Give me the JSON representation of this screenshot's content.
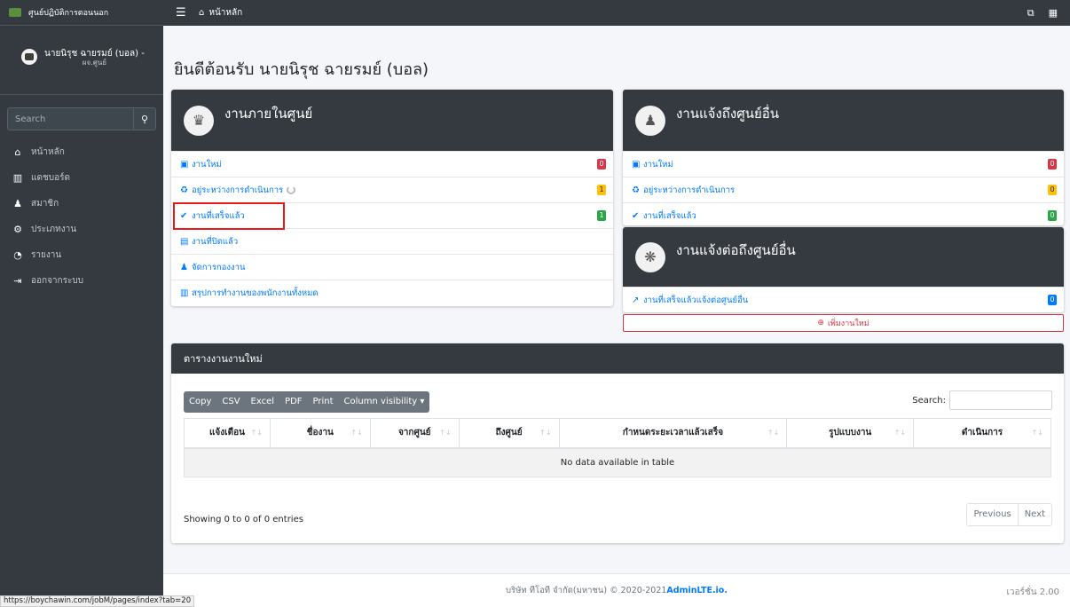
{
  "brand": {
    "name": "ศูนย์ปฏิบัติการตอนนอก"
  },
  "user": {
    "name": "นายนิรุช ฉายรมย์ (บอล) -",
    "role": "ผจ.ศูนย์"
  },
  "sidebar": {
    "search_placeholder": "Search",
    "items": [
      {
        "icon": "home-icon",
        "glyph": "⌂",
        "label": "หน้าหลัก"
      },
      {
        "icon": "chart-icon",
        "glyph": "▥",
        "label": "แดชบอร์ด"
      },
      {
        "icon": "users-icon",
        "glyph": "♟",
        "label": "สมาชิก"
      },
      {
        "icon": "cogs-icon",
        "glyph": "⚙",
        "label": "ประเภทงาน"
      },
      {
        "icon": "chart-pie-icon",
        "glyph": "◔",
        "label": "รายงาน"
      },
      {
        "icon": "sign-out-icon",
        "glyph": "⇥",
        "label": "ออกจากระบบ"
      }
    ]
  },
  "topbar": {
    "home_label": "หน้าหลัก"
  },
  "page": {
    "title": "ยินดีต้อนรับ นายนิรุช ฉายรมย์ (บอล)"
  },
  "card_internal": {
    "title": "งานภายในศูนย์",
    "items": [
      {
        "icon": "plus-square-icon",
        "glyph": "▣",
        "label": "งานใหม่",
        "badge": "0",
        "badge_color": "#dc3545"
      },
      {
        "icon": "recycle-icon",
        "glyph": "♻",
        "label": "อยู่ระหว่างการดำเนินการ",
        "badge": "1",
        "badge_color": "#ffc107"
      },
      {
        "icon": "check-circle-icon",
        "glyph": "✔",
        "label": "งานที่เสร็จแล้ว",
        "badge": "1",
        "badge_color": "#28a745"
      },
      {
        "icon": "id-card-icon",
        "glyph": "▤",
        "label": "งานที่ปิดแล้ว"
      },
      {
        "icon": "users-cog-icon",
        "glyph": "♟",
        "label": "จัดการกองงาน"
      },
      {
        "icon": "chart-icon",
        "glyph": "▥",
        "label": "สรุปการทำงานของพนักงานทั้งหมด"
      }
    ]
  },
  "card_notify": {
    "title": "งานแจ้งถึงศูนย์อื่น",
    "items": [
      {
        "icon": "plus-square-icon",
        "glyph": "▣",
        "label": "งานใหม่",
        "badge": "0",
        "badge_color": "#dc3545"
      },
      {
        "icon": "recycle-icon",
        "glyph": "♻",
        "label": "อยู่ระหว่างการดำเนินการ",
        "badge": "0",
        "badge_color": "#ffc107"
      },
      {
        "icon": "check-circle-icon",
        "glyph": "✔",
        "label": "งานที่เสร็จแล้ว",
        "badge": "0",
        "badge_color": "#28a745"
      }
    ]
  },
  "card_forward": {
    "title": "งานแจ้งต่อถึงศูนย์อื่น",
    "items": [
      {
        "icon": "share-icon",
        "glyph": "↗",
        "label": "งานที่เสร็จแล้วแจ้งต่อศูนย์อื่น",
        "badge": "0",
        "badge_color": "#007bff"
      }
    ],
    "add_button": "เพิ่มงานใหม่"
  },
  "table_card": {
    "title": "ตารางงานงานใหม่",
    "buttons": [
      "Copy",
      "CSV",
      "Excel",
      "PDF",
      "Print",
      "Column visibility ▾"
    ],
    "search_label": "Search:",
    "columns": [
      "แจ้งเตือน",
      "ชื่องาน",
      "จากศูนย์",
      "ถึงศูนย์",
      "กำหนดระยะเวลาแล้วเสร็จ",
      "รูปแบบงาน",
      "ดำเนินการ"
    ],
    "empty": "No data available in table",
    "info": "Showing 0 to 0 of 0 entries",
    "prev": "Previous",
    "next": "Next"
  },
  "footer": {
    "text": "บริษัท ทีโอที จำกัด(มหาชน) © 2020-2021 ",
    "link": "AdminLTE.io.",
    "version": "เวอร์ชั่น 2.00"
  },
  "status_url": "https://boychawin.com/jobM/pages/index?tab=20"
}
